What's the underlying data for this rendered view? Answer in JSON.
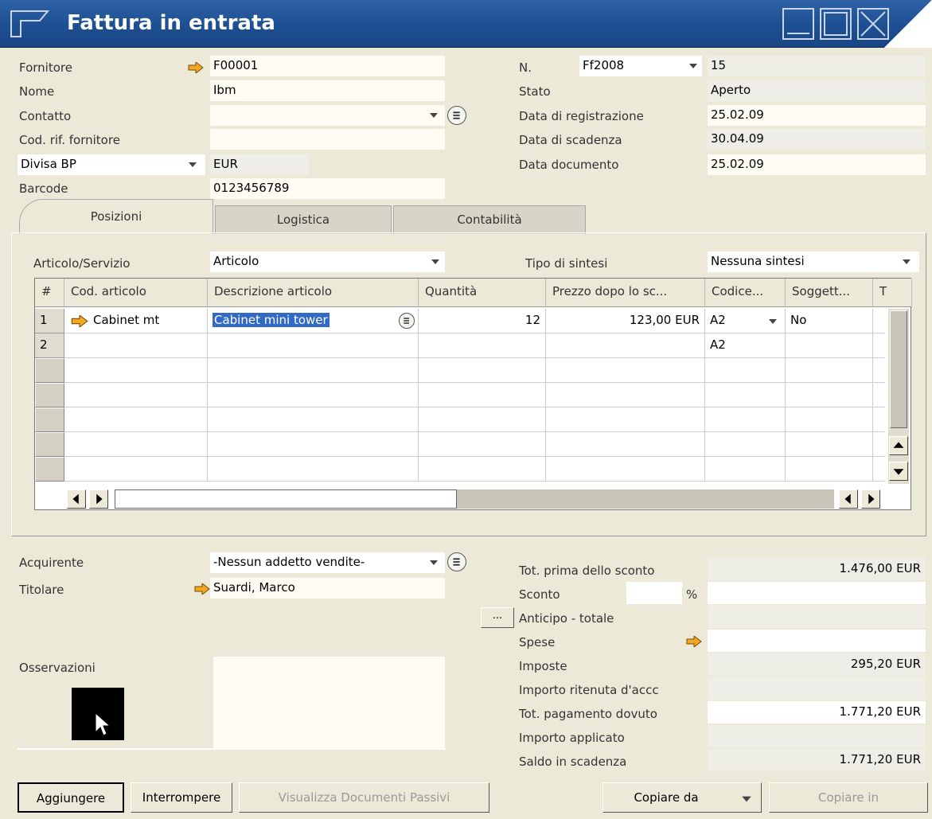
{
  "window": {
    "title": "Fattura in entrata"
  },
  "header_left": {
    "fornitore_label": "Fornitore",
    "fornitore_value": "F00001",
    "nome_label": "Nome",
    "nome_value": "Ibm",
    "contatto_label": "Contatto",
    "contatto_value": "",
    "codrif_label": "Cod. rif. fornitore",
    "codrif_value": "",
    "divisa_label": "Divisa BP",
    "divisa_value": "EUR",
    "barcode_label": "Barcode",
    "barcode_value": "0123456789"
  },
  "header_right": {
    "n_label": "N.",
    "series_value": "Ff2008",
    "number_value": "15",
    "stato_label": "Stato",
    "stato_value": "Aperto",
    "data_reg_label": "Data di registrazione",
    "data_reg_value": "25.02.09",
    "data_scad_label": "Data di scadenza",
    "data_scad_value": "30.04.09",
    "data_doc_label": "Data documento",
    "data_doc_value": "25.02.09"
  },
  "tabs": [
    {
      "label": "Posizioni"
    },
    {
      "label": "Logistica"
    },
    {
      "label": "Contabilità"
    }
  ],
  "positions": {
    "tipo_label": "Articolo/Servizio",
    "tipo_value": "Articolo",
    "sintesi_label": "Tipo di sintesi",
    "sintesi_value": "Nessuna sintesi",
    "columns": [
      "#",
      "Cod. articolo",
      "Descrizione articolo",
      "Quantità",
      "Prezzo dopo lo sc...",
      "Codice...",
      "Soggett...",
      "T"
    ],
    "rows": [
      {
        "num": "1",
        "cod": "Cabinet mt",
        "descr": "Cabinet mini tower",
        "qty": "12",
        "price": "123,00 EUR",
        "codice": "A2",
        "soggetto": "No"
      },
      {
        "num": "2",
        "cod": "",
        "descr": "",
        "qty": "",
        "price": "",
        "codice": "A2",
        "soggetto": ""
      }
    ]
  },
  "bottom_left": {
    "acquirente_label": "Acquirente",
    "acquirente_value": "-Nessun addetto vendite-",
    "titolare_label": "Titolare",
    "titolare_value": "Suardi, Marco",
    "osservazioni_label": "Osservazioni"
  },
  "totals": {
    "tot_prima_label": "Tot. prima dello sconto",
    "tot_prima_value": "1.476,00 EUR",
    "sconto_label": "Sconto",
    "sconto_pct": "%",
    "anticipo_label": "Anticipo - totale",
    "anticipo_btn": "...",
    "spese_label": "Spese",
    "imposte_label": "Imposte",
    "imposte_value": "295,20 EUR",
    "ritenuta_label": "Importo ritenuta d'accc",
    "tot_pag_label": "Tot. pagamento dovuto",
    "tot_pag_value": "1.771,20 EUR",
    "importo_app_label": "Importo applicato",
    "saldo_label": "Saldo in scadenza",
    "saldo_value": "1.771,20 EUR"
  },
  "buttons": {
    "aggiungere": "Aggiungere",
    "interrompere": "Interrompere",
    "visualizza": "Visualizza Documenti Passivi",
    "copiare_da": "Copiare da",
    "copiare_in": "Copiare in"
  },
  "colors": {
    "title_bar": "#1d4f92",
    "link_arrow": "#f5a623",
    "selection": "#316ac5",
    "window_bg": "#ece9d8"
  }
}
